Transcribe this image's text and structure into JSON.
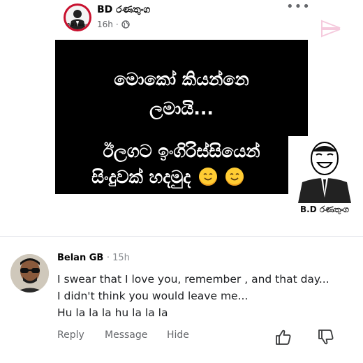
{
  "post": {
    "page_name": "BD රණතුංග",
    "time": "16h",
    "avatar_label": "B.D රණතුංග",
    "more_label": "•••",
    "meme_lines": [
      "මොකෝ කියන්නෙ",
      "ලමායි...",
      "ඊලගට ඉංගිරිස්සියෙන්",
      "සිංදුවක් හදමුද"
    ],
    "sticker_caption": "B.D රණතුංග"
  },
  "comment": {
    "author": "Belan GB",
    "time": "15h",
    "text": "I swear that I love you, remember , and that day... I didn't think you would leave me...\nHu la la la hu la la la",
    "actions": {
      "reply": "Reply",
      "message": "Message",
      "hide": "Hide"
    }
  },
  "icons": [
    "globe-icon",
    "more-icon",
    "thumbs-up-icon",
    "thumbs-down-icon",
    "grinning-face-emoji",
    "watermark-icon"
  ],
  "colors": {
    "meme_background": "#000000",
    "meta_gray": "#65676b",
    "avatar_red": "#c8102e"
  }
}
